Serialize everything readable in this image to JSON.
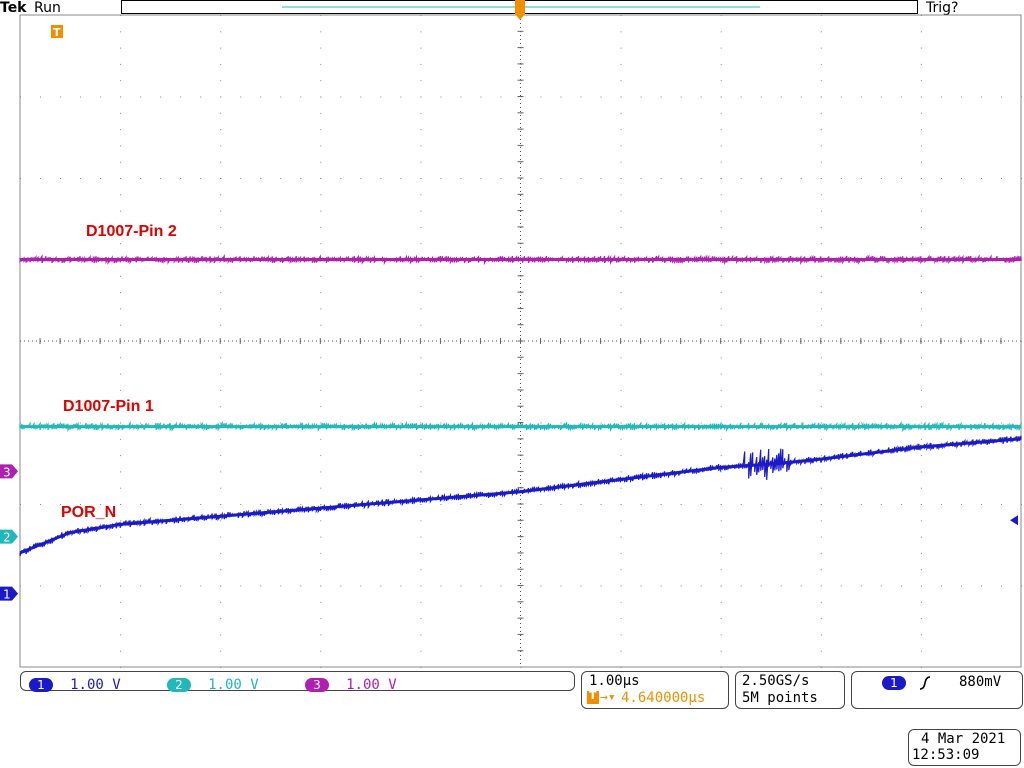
{
  "header": {
    "brand": "Tek",
    "run_state": "Run",
    "trigger_state": "Trig?"
  },
  "colors": {
    "ch1": "#1a1ac8",
    "ch2": "#20b8b8",
    "ch3": "#b020b0",
    "trigger": "#f09000",
    "annotation": "#e00000"
  },
  "annotations": {
    "pin2": "D1007-Pin 2",
    "pin1": "D1007-Pin 1",
    "por": "POR_N"
  },
  "markers": {
    "ch1": "1",
    "ch2": "2",
    "ch3": "3",
    "trigger": "T"
  },
  "channels": [
    {
      "badge": "1",
      "scale": "1.00 V"
    },
    {
      "badge": "2",
      "scale": "1.00 V"
    },
    {
      "badge": "3",
      "scale": "1.00 V"
    }
  ],
  "timebase": {
    "scale": "1.00µs",
    "trigger_position": "4.640000µs"
  },
  "acquisition": {
    "sample_rate": "2.50GS/s",
    "record_length": "5M points"
  },
  "trigger": {
    "source": "1",
    "slope_icon": "rising-edge-icon",
    "level": "880mV"
  },
  "datetime": {
    "date": "4 Mar  2021",
    "time": "12:53:09"
  },
  "chart_data": {
    "type": "line",
    "xlim": [
      0,
      10
    ],
    "ylim": [
      -4,
      4
    ],
    "grid": true,
    "series": [
      {
        "name": "D1007-Pin 2",
        "channel": 3,
        "x": [
          0,
          10
        ],
        "values": [
          1.0,
          1.0
        ]
      },
      {
        "name": "D1007-Pin 1",
        "channel": 2,
        "x": [
          0,
          10
        ],
        "values": [
          -1.05,
          -1.05
        ]
      },
      {
        "name": "POR_N",
        "channel": 1,
        "x": [
          0,
          0.5,
          1,
          2,
          3,
          4,
          5,
          6,
          7,
          7.6,
          8,
          9,
          10
        ],
        "values": [
          -2.6,
          -2.35,
          -2.25,
          -2.15,
          -2.05,
          -1.95,
          -1.85,
          -1.7,
          -1.55,
          -1.5,
          -1.45,
          -1.3,
          -1.2
        ]
      }
    ]
  }
}
